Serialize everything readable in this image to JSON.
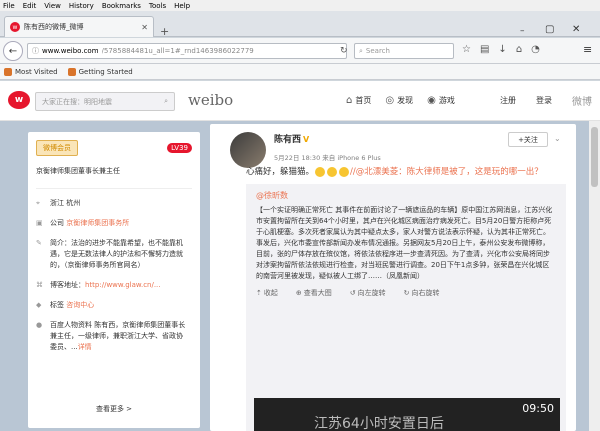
{
  "browser": {
    "menu": [
      "File",
      "Edit",
      "View",
      "History",
      "Bookmarks",
      "Tools",
      "Help"
    ],
    "tab_title": "陈有西的微博_微博",
    "url_host": "www.weibo.com",
    "url_rest": "/5785884481u_all=1#_rnd1463986022779",
    "search_placeholder": "Search",
    "bookmarks": [
      "Most Visited",
      "Getting Started"
    ]
  },
  "weibo": {
    "search_placeholder": "大家正在搜：明阳地震",
    "brand": "weibo",
    "nav": [
      "首页",
      "发现",
      "游戏"
    ],
    "register": "注册",
    "login": "登录",
    "right_text": "微博"
  },
  "profile": {
    "vip_label": "微博会员",
    "level": "LV39",
    "verify": "京衡律师集团董事长兼主任",
    "location": "浙江 杭州",
    "company_prefix": "公司",
    "company": "京衡律师集团事务所",
    "intro_prefix": "简介：",
    "intro": "法治的进步不能靠希望，也不能靠机遇，它是无数法律人的护法和不懈努力造就的，（京衡律师事务所官网名）",
    "blog_prefix": "博客地址：",
    "blog": "http://www.glaw.cn/...",
    "school_prefix": "标签",
    "school": "咨询中心",
    "intro2": "百度人物资料 陈有西，京衡律师集团董事长兼主任，一级律师，兼职浙江大学、省政协 委员、...",
    "intro2_link": "详情",
    "see_more": "查看更多 >"
  },
  "post": {
    "author": "陈有西",
    "follow": "+关注",
    "time": "5月22日 18:30 来自 iPhone 6 Plus",
    "text_prefix": "心痛好，躲猫猫。",
    "text_suffix": "//@北漂美菱：陈大律师是被了，这是玩的哪一出？",
    "repost_author": "@徐昕数",
    "repost_text": "【一个实证明确正常死亡 其事件在前面讨论了一辆遮运品的车辆】原中国江苏网消息，江苏兴化市安置拘留所在关到64个小时里，其卢在兴化城区病面治疗病发死亡。目5月20日警方拒称卢死于心肌梗塞。多次死者家属认为其中疑点太多，家人对警方说法表示怀疑，认为其非正常死亡。事发后，兴化市委宣传部新闻办发布情况通报。另据网友5月20日上午，泰州公安发布微博称，目前，张的尸体存放在殡仪馆，将依法依程序进一步查清死因。为了查清，兴化市公安局将同步对涉案拘留所依法依规进行检查，对当班民警进行调查。20日下午1点多钟，张荣昌在兴化城区的南营河里被发现，疑似被人工绑了……（凤凰新闻）",
    "actions": [
      "收起",
      "查看大图",
      "向左旋转",
      "向右旋转"
    ],
    "phone_time": "09:50",
    "phone_sub": "江苏64小时安置日后"
  }
}
